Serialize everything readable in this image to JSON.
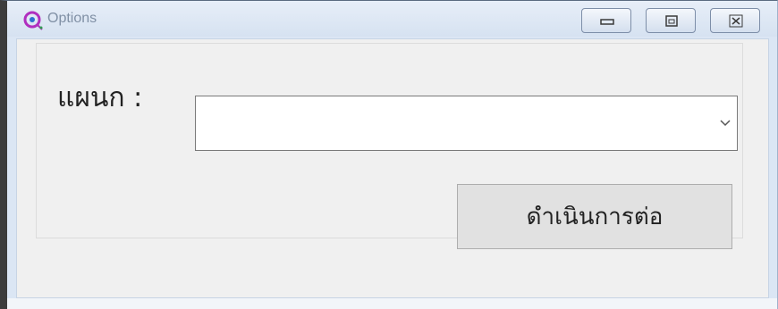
{
  "window": {
    "title": "Options",
    "icon": "app-icon",
    "controls": {
      "minimize": "minimize-icon",
      "maximize": "maximize-icon",
      "close": "close-icon"
    }
  },
  "form": {
    "department_label": "แผนก :",
    "department_value": "",
    "proceed_label": "ดำเนินการต่อ"
  }
}
